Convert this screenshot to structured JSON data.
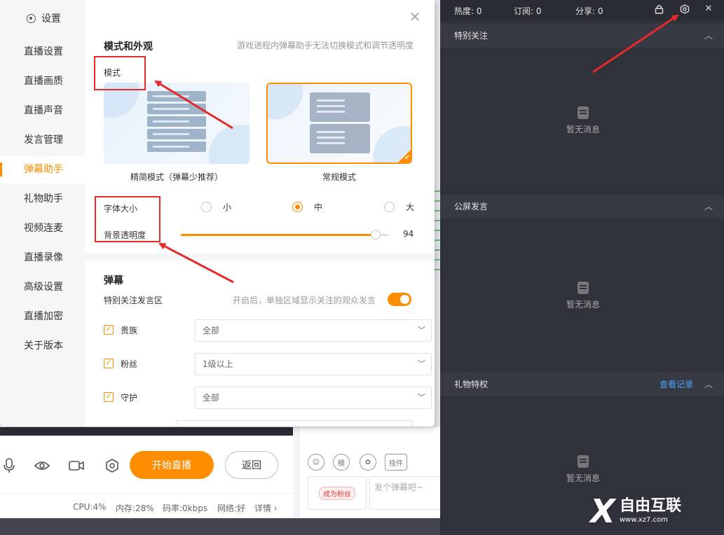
{
  "background_app": {
    "start_button": "开始直播",
    "back_button": "返回",
    "status": {
      "cpu": "CPU:4%",
      "memory": "内存:28%",
      "bitrate": "码率:0kbps",
      "network": "网络:好",
      "details": "详情 ›"
    },
    "chat": {
      "fan_badge": "成为粉丝",
      "input_placeholder": "发个弹幕吧~",
      "icons": [
        "smile-icon",
        "sticker-icon",
        "palette-icon",
        "plugin-icon"
      ],
      "plugin_label": "挂件"
    }
  },
  "dialog": {
    "title": "设置",
    "sidebar": [
      {
        "label": "直播设置"
      },
      {
        "label": "直播画质"
      },
      {
        "label": "直播声音"
      },
      {
        "label": "发言管理"
      },
      {
        "label": "弹幕助手",
        "active": true
      },
      {
        "label": "礼物助手"
      },
      {
        "label": "视频连麦"
      },
      {
        "label": "直播录像"
      },
      {
        "label": "高级设置"
      },
      {
        "label": "直播加密"
      },
      {
        "label": "关于版本"
      }
    ],
    "appearance": {
      "title": "模式和外观",
      "hint": "游戏进程内弹幕助手无法切换模式和调节透明度",
      "mode_label": "模式",
      "modes": [
        {
          "label": "精简模式（弹幕少推荐）",
          "selected": false
        },
        {
          "label": "常规模式",
          "selected": true
        }
      ],
      "font_size_label": "字体大小",
      "font_sizes": [
        {
          "label": "小",
          "selected": false
        },
        {
          "label": "中",
          "selected": true
        },
        {
          "label": "大",
          "selected": false
        }
      ],
      "opacity_label": "背景透明度",
      "opacity_value": 94
    },
    "danmaku": {
      "title": "弹幕",
      "special_label": "特别关注发言区",
      "special_hint": "开启后，单独区域显示关注的观众发言",
      "special_enabled": true,
      "filters": [
        {
          "label": "贵族",
          "value": "全部",
          "checked": true
        },
        {
          "label": "粉丝",
          "value": "1级以上",
          "checked": true
        },
        {
          "label": "守护",
          "value": "全部",
          "checked": true
        }
      ]
    }
  },
  "right_panel": {
    "stats": {
      "heat": "热度: 0",
      "subscribe": "订阅: 0",
      "share": "分享: 0"
    },
    "sections": [
      {
        "title": "特别关注",
        "empty_text": "暂无消息"
      },
      {
        "title": "公屏发言",
        "empty_text": "暂无消息"
      },
      {
        "title": "礼物特权",
        "empty_text": "暂无消息",
        "action": "查看记录"
      }
    ]
  },
  "watermark": {
    "name": "自由互联",
    "url": "www.xz7.com"
  },
  "colors": {
    "accent": "#ff8d00",
    "annotation_red": "#e52a2a",
    "dark_panel": "#2f323a",
    "link_blue": "#4aa3ff"
  }
}
